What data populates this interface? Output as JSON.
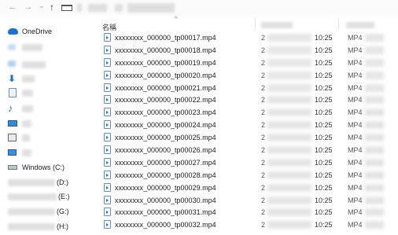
{
  "toolbar": {
    "back_glyph": "←",
    "forward_glyph": "→",
    "dropdown_glyph": "⌄",
    "up_glyph": "↑"
  },
  "sidebar": {
    "onedrive_label": "OneDrive",
    "windows_drive_label": "Windows (C:)",
    "drive_d_label": "(D:)",
    "drive_e_label": "(E:)",
    "drive_g_label": "(G:)",
    "drive_h_label": "(H:)",
    "icons": [
      "cloud-icon",
      "monitor-icon",
      "download-icon",
      "document-icon",
      "music-icon",
      "desktop-icon",
      "pictures-icon",
      "this-pc-icon",
      "drive-icon"
    ]
  },
  "list": {
    "name_header": "名稱",
    "sort_glyph": "^",
    "files": [
      {
        "name": "xxxxxxxx_000000_tp00017.mp4",
        "date_prefix": "2",
        "time": "10:25",
        "type": "MP4"
      },
      {
        "name": "xxxxxxxx_000000_tp00018.mp4",
        "date_prefix": "2",
        "time": "10:25",
        "type": "MP4"
      },
      {
        "name": "xxxxxxxx_000000_tp00019.mp4",
        "date_prefix": "2",
        "time": "10:25",
        "type": "MP4"
      },
      {
        "name": "xxxxxxxx_000000_tp00020.mp4",
        "date_prefix": "2",
        "time": "10:25",
        "type": "MP4"
      },
      {
        "name": "xxxxxxxx_000000_tp00021.mp4",
        "date_prefix": "2",
        "time": "10:25",
        "type": "MP4"
      },
      {
        "name": "xxxxxxxx_000000_tp00022.mp4",
        "date_prefix": "2",
        "time": "10:25",
        "type": "MP4"
      },
      {
        "name": "xxxxxxxx_000000_tp00023.mp4",
        "date_prefix": "2",
        "time": "10:25",
        "type": "MP4"
      },
      {
        "name": "xxxxxxxx_000000_tp00024.mp4",
        "date_prefix": "2",
        "time": "10:25",
        "type": "MP4"
      },
      {
        "name": "xxxxxxxx_000000_tp00025.mp4",
        "date_prefix": "2",
        "time": "10:25",
        "type": "MP4"
      },
      {
        "name": "xxxxxxxx_000000_tp00026.mp4",
        "date_prefix": "2",
        "time": "10:25",
        "type": "MP4"
      },
      {
        "name": "xxxxxxxx_000000_tp00027.mp4",
        "date_prefix": "2",
        "time": "10:25",
        "type": "MP4"
      },
      {
        "name": "xxxxxxxx_000000_tp00028.mp4",
        "date_prefix": "2",
        "time": "10:25",
        "type": "MP4"
      },
      {
        "name": "xxxxxxxx_000000_tp00029.mp4",
        "date_prefix": "2",
        "time": "10:25",
        "type": "MP4"
      },
      {
        "name": "xxxxxxxx_000000_tp00030.mp4",
        "date_prefix": "2",
        "time": "10:25",
        "type": "MP4"
      },
      {
        "name": "xxxxxxxx_000000_tp00031.mp4",
        "date_prefix": "2",
        "time": "10:25",
        "type": "MP4"
      },
      {
        "name": "xxxxxxxx_000000_tp00032.mp4",
        "date_prefix": "2",
        "time": "10:25",
        "type": "MP4"
      }
    ]
  }
}
